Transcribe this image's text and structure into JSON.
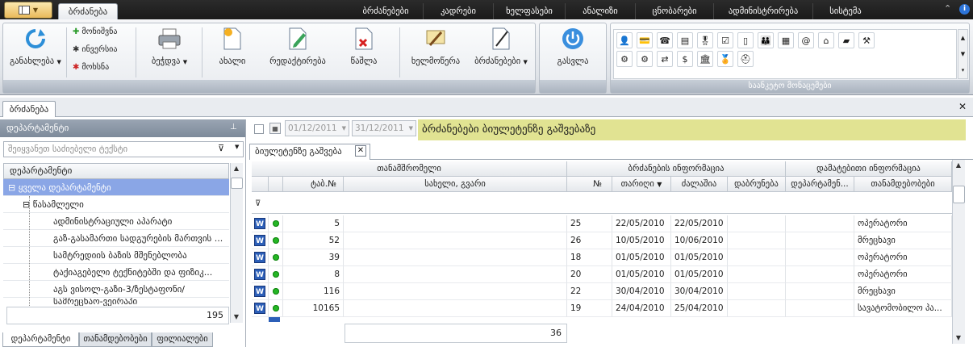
{
  "app": {
    "active_tab": "ბრძანება",
    "menu_tabs": [
      "ბრძანებები",
      "კადრები",
      "ხელფასები",
      "ანალიზი",
      "ცნობარები",
      "ადმინისტრირება",
      "სისტემა"
    ]
  },
  "ribbon": {
    "refresh_label": "განახლება",
    "mark_label": "მონიშვნა",
    "invert_label": "ინვერსია",
    "remove_label": "მოხსნა",
    "print_label": "ბეჭდვა",
    "new_label": "ახალი",
    "edit_label": "რედაქტირება",
    "delete_label": "წაშლა",
    "sign_label": "ხელმოწერა",
    "orders_label": "ბრძანებები",
    "exit_label": "გასვლა",
    "gallery_caption": "საანკეტო მონაცემები"
  },
  "doc_tab": {
    "label": "ბრძანება"
  },
  "left_panel": {
    "header": "დეპარტამენტი",
    "search_placeholder": "შეიყვანეთ საძიებელი ტექსტი",
    "tree_header": "დეპარტამენტი",
    "tree": [
      "ყველა დეპარტამენტი",
      "წასამლელი",
      "ადმინისტრაციული აპარატი",
      "გაზ-გასამართი სადგურების მართვის ...",
      "სამტრედიის ბაზის მშენებლობა",
      "ტაქიაგებელი ტექნიტებში და ფიზიკ...",
      "აგს ვისოლ-გაზი-3/ზესტაფონი/",
      "სამრეცხაო-ვეირაპი"
    ],
    "footer_count": "195",
    "bottom_tabs": [
      "დეპარტამენტი",
      "თანამდებობები",
      "ფილიალები"
    ]
  },
  "filter": {
    "date_from": "01/12/2011",
    "date_to": "31/12/2011",
    "banner": "ბრძანებები ბიულეტენზე გაშვებაზე"
  },
  "grid": {
    "tab_label": "ბიულეტენზე გაშვება",
    "group_headers": [
      "თანამშრომელი",
      "ბრძანების ინფორმაცია",
      "დამატებითი ინფორმაცია"
    ],
    "columns": [
      "ტაბ.№",
      "სახელი, გვარი",
      "№",
      "თარიღი",
      "ძალაშია",
      "დაბრუნება",
      "დეპარტამენ...",
      "თანამდებობები"
    ],
    "rows": [
      {
        "tab": "5",
        "name": "",
        "num": "25",
        "date": "22/05/2010",
        "valid": "22/05/2010",
        "ret": "",
        "dept": "",
        "pos": "ოპერატორი"
      },
      {
        "tab": "52",
        "name": "",
        "num": "26",
        "date": "10/05/2010",
        "valid": "10/06/2010",
        "ret": "",
        "dept": "",
        "pos": "მრეცხავი"
      },
      {
        "tab": "39",
        "name": "",
        "num": "18",
        "date": "01/05/2010",
        "valid": "01/05/2010",
        "ret": "",
        "dept": "",
        "pos": "ოპერატორი"
      },
      {
        "tab": "8",
        "name": "",
        "num": "20",
        "date": "01/05/2010",
        "valid": "01/05/2010",
        "ret": "",
        "dept": "",
        "pos": "ოპერატორი"
      },
      {
        "tab": "116",
        "name": "",
        "num": "22",
        "date": "30/04/2010",
        "valid": "30/04/2010",
        "ret": "",
        "dept": "",
        "pos": "მრეცხავი"
      },
      {
        "tab": "10165",
        "name": "",
        "num": "19",
        "date": "24/04/2010",
        "valid": "25/04/2010",
        "ret": "",
        "dept": "",
        "pos": "სავატომობილო პა..."
      }
    ],
    "footer_count": "36"
  },
  "colors": {
    "banner": "#e1e392",
    "selection": "#8aa6e6",
    "accent": "#2c5fb8"
  }
}
